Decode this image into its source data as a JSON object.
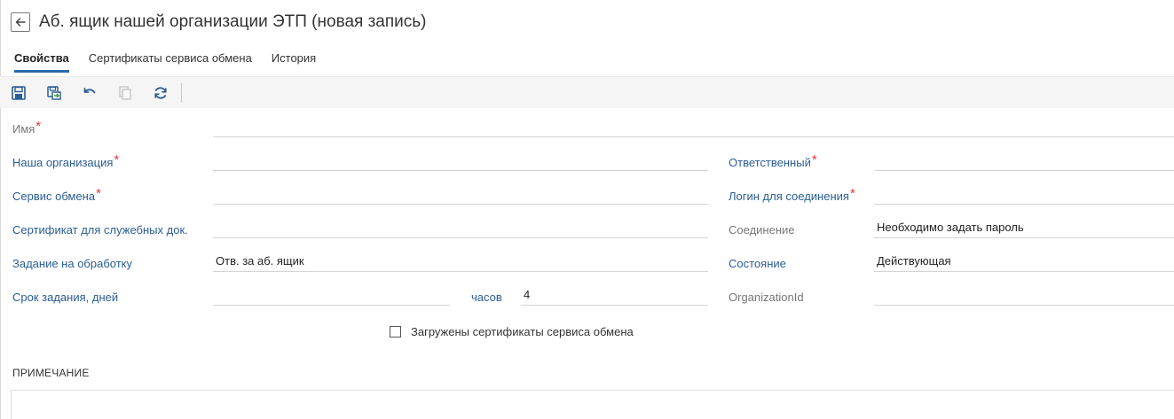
{
  "header": {
    "title": "Аб. ящик нашей организации ЭТП (новая запись)"
  },
  "tabs": [
    {
      "label": "Свойства",
      "active": true
    },
    {
      "label": "Сертификаты сервиса обмена",
      "active": false
    },
    {
      "label": "История",
      "active": false
    }
  ],
  "toolbar": {
    "icons": [
      "save-icon",
      "save-and-close-icon",
      "undo-icon",
      "copy-icon",
      "refresh-icon"
    ]
  },
  "form": {
    "name": {
      "label": "Имя",
      "required": "*",
      "value": ""
    },
    "our_org": {
      "label": "Наша организация",
      "required": "*",
      "value": ""
    },
    "exchange_service": {
      "label": "Сервис обмена",
      "required": "*",
      "value": ""
    },
    "service_cert": {
      "label": "Сертификат для служебных док.",
      "value": ""
    },
    "task": {
      "label": "Задание на обработку",
      "value": "Отв. за аб. ящик"
    },
    "task_deadline": {
      "label": "Срок задания, дней",
      "value": "",
      "hours_label": "часов",
      "hours_value": "4"
    },
    "responsible": {
      "label": "Ответственный",
      "required": "*",
      "value": ""
    },
    "login": {
      "label": "Логин для соединения",
      "required": "*",
      "value": ""
    },
    "connection": {
      "label": "Соединение",
      "value": "Необходимо задать пароль"
    },
    "state": {
      "label": "Состояние",
      "value": "Действующая"
    },
    "organization_id": {
      "label": "OrganizationId",
      "value": ""
    },
    "certs_loaded": {
      "label": "Загружены сертификаты сервиса обмена",
      "checked": false
    }
  },
  "note": {
    "title": "ПРИМЕЧАНИЕ",
    "value": ""
  },
  "colors": {
    "label_blue": "#2a5d94",
    "label_gray": "#777777",
    "required_red": "#e0393e",
    "tab_active": "#2b6aa8",
    "toolbar_icon": "#2a5d94"
  }
}
